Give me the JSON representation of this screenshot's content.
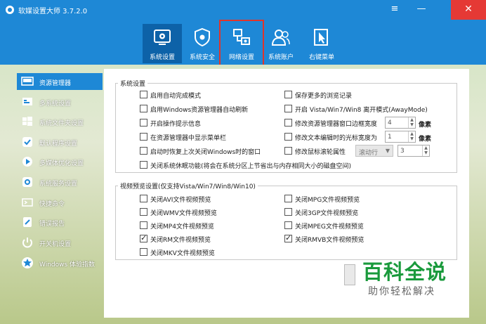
{
  "window": {
    "title": "软媒设置大师 3.7.2.0",
    "controls": {
      "menu": "≡",
      "minimize": "—",
      "close": "✕"
    }
  },
  "toolbar": {
    "tabs": [
      {
        "label": "系统设置",
        "icon": "gear-screen-icon",
        "active": true
      },
      {
        "label": "系统安全",
        "icon": "shield-gear-icon",
        "active": false
      },
      {
        "label": "网络设置",
        "icon": "network-icon",
        "active": false
      },
      {
        "label": "系统账户",
        "icon": "users-icon",
        "active": false
      },
      {
        "label": "右键菜单",
        "icon": "cursor-menu-icon",
        "active": false
      }
    ],
    "highlight_color": "#e0352b"
  },
  "sidebar": {
    "items": [
      {
        "label": "资源管理器",
        "icon": "monitor-icon",
        "active": true
      },
      {
        "label": "多系统设置",
        "icon": "multi-system-icon"
      },
      {
        "label": "系统文件夹设置",
        "icon": "windows-folder-icon"
      },
      {
        "label": "默认程序设置",
        "icon": "check-shield-icon"
      },
      {
        "label": "多媒体优化设置",
        "icon": "media-play-icon"
      },
      {
        "label": "系统服务设置",
        "icon": "service-gear-icon"
      },
      {
        "label": "快捷命令",
        "icon": "command-icon"
      },
      {
        "label": "错误报告",
        "icon": "report-icon"
      },
      {
        "label": "开关机设置",
        "icon": "power-icon"
      },
      {
        "label": "Windows 体验指数",
        "icon": "star-icon"
      }
    ]
  },
  "system_settings": {
    "title": "系统设置",
    "left": [
      {
        "label": "启用自动完成模式",
        "checked": false
      },
      {
        "label": "启用Windows资源管理器自动刷新",
        "checked": false
      },
      {
        "label": "开启操作提示信息",
        "checked": false
      },
      {
        "label": "在资源管理器中显示菜单栏",
        "checked": false
      },
      {
        "label": "启动时恢复上次关闭Windows时的窗口",
        "checked": false
      }
    ],
    "right": [
      {
        "label": "保存更多的浏览记录",
        "checked": false
      },
      {
        "label": "开启 Vista/Win7/Win8 离开模式(AwayMode)",
        "checked": false
      },
      {
        "label": "修改资源管理器窗口边框宽度",
        "checked": false,
        "value": "4",
        "unit": "像素"
      },
      {
        "label": "修改文本编辑时的光标宽度为",
        "checked": false,
        "value": "1",
        "unit": "像素"
      },
      {
        "label": "修改鼠标滚轮属性",
        "checked": false,
        "select": "滚动行",
        "value": "3"
      }
    ],
    "full": {
      "label": "关闭系统休眠功能(将会在系统分区上节省出与内存相同大小的磁盘空间)",
      "checked": false
    }
  },
  "preview_settings": {
    "title": "视频预览设置(仅支持Vista/Win7/Win8/Win10)",
    "left": [
      {
        "label": "关闭AVI文件视频预览",
        "checked": false
      },
      {
        "label": "关闭WMV文件视频预览",
        "checked": false
      },
      {
        "label": "关闭MP4文件视频预览",
        "checked": false
      },
      {
        "label": "关闭RM文件视频预览",
        "checked": true
      },
      {
        "label": "关闭MKV文件视频预览",
        "checked": false
      }
    ],
    "right": [
      {
        "label": "关闭MPG文件视频预览",
        "checked": false
      },
      {
        "label": "关闭3GP文件视频预览",
        "checked": false
      },
      {
        "label": "关闭MPEG文件视频预览",
        "checked": false
      },
      {
        "label": "关闭RMVB文件视频预览",
        "checked": true
      }
    ]
  },
  "watermark": {
    "title": "百科全说",
    "subtitle": "助你轻松解决"
  }
}
